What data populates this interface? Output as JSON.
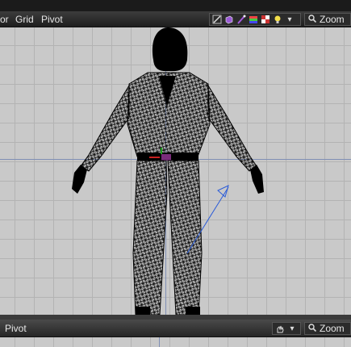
{
  "top_menu": {
    "item1": "or",
    "item2": "Grid",
    "item3": "Pivot"
  },
  "toolbar": {
    "zoom_label": "Zoom"
  },
  "bottom_bar": {
    "pivot": "Pivot",
    "zoom_label": "Zoom"
  },
  "icons": {
    "pencil": "pencil-icon",
    "cube": "cube-icon",
    "brush": "brush-icon",
    "color-swatch": "color-swatch-icon",
    "checker": "checker-icon",
    "light": "light-icon",
    "dropdown": "chevron-down-icon",
    "search": "search-icon"
  },
  "colors": {
    "accent_blue": "#2a5bd8",
    "axis_line": "#7f8fb4",
    "grid_bg": "#c9c9c9"
  }
}
